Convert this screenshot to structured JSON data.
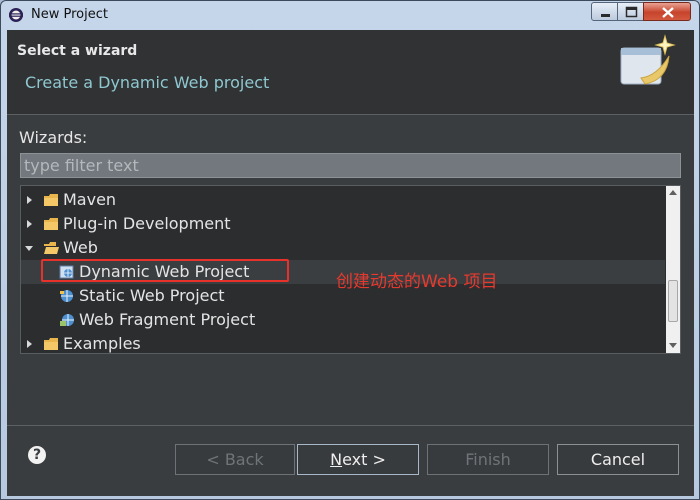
{
  "window": {
    "title": "New Project"
  },
  "header": {
    "title": "Select a wizard",
    "description": "Create a Dynamic Web project"
  },
  "wizards": {
    "label": "Wizards:",
    "filter_placeholder": "type filter text",
    "tree": [
      {
        "label": "Maven",
        "kind": "folder",
        "state": "collapsed"
      },
      {
        "label": "Plug-in Development",
        "kind": "folder",
        "state": "collapsed"
      },
      {
        "label": "Web",
        "kind": "folder",
        "state": "expanded"
      },
      {
        "label": "Dynamic Web Project",
        "kind": "wizard",
        "selected": true
      },
      {
        "label": "Static Web Project",
        "kind": "wizard"
      },
      {
        "label": "Web Fragment Project",
        "kind": "wizard"
      },
      {
        "label": "Examples",
        "kind": "folder",
        "state": "collapsed"
      }
    ]
  },
  "annotation": {
    "text": "创建动态的Web 项目",
    "color": "#e8312a"
  },
  "buttons": {
    "help": "?",
    "back": "< Back",
    "next_mnemonic": "N",
    "next_rest": "ext >",
    "finish": "Finish",
    "cancel": "Cancel"
  },
  "colors": {
    "background": "#3a3d3f",
    "header": "#303234",
    "tree": "#2b2d2f",
    "accent_text": "#8fc8d0",
    "highlight": "#e8312a"
  }
}
